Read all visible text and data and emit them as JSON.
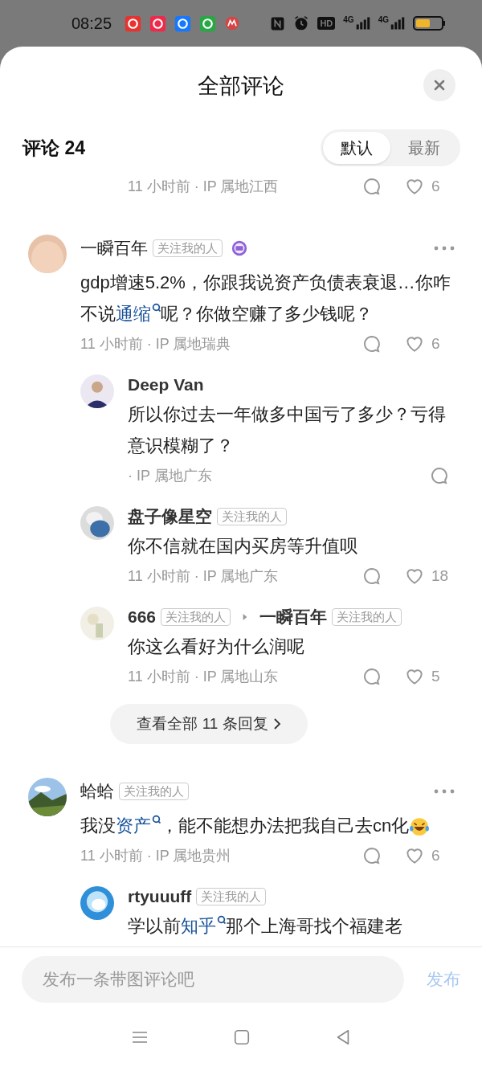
{
  "status_bar": {
    "time": "08:25",
    "hd_label": "HD",
    "networks": [
      "4G",
      "4G"
    ]
  },
  "sheet": {
    "title": "全部评论"
  },
  "comments_header": {
    "label": "评论 24",
    "sort_tabs": [
      {
        "label": "默认",
        "selected": true
      },
      {
        "label": "最新",
        "selected": false
      }
    ]
  },
  "comments": [
    {
      "meta": "11 小时前 · IP 属地江西",
      "likes": "6"
    },
    {
      "author": "一瞬百年",
      "badge": "关注我的人",
      "medal": true,
      "body": [
        {
          "kind": "text",
          "text": "gdp增速5.2%，你跟我说资产负债表衰退…你咋不说"
        },
        {
          "kind": "link",
          "text": "通缩"
        },
        {
          "kind": "text",
          "text": "呢？你做空赚了多少钱呢？"
        }
      ],
      "meta": "11 小时前 · IP 属地瑞典",
      "likes": "6",
      "replies": [
        {
          "author": "Deep Van",
          "body": [
            {
              "kind": "text",
              "text": "所以你过去一年做多中国亏了多少？亏得意识模糊了？"
            }
          ],
          "meta": "· IP 属地广东"
        },
        {
          "author": "盘子像星空",
          "badge": "关注我的人",
          "body": [
            {
              "kind": "text",
              "text": "你不信就在国内买房等升值呗"
            }
          ],
          "meta": "11 小时前 · IP 属地广东",
          "likes": "18"
        },
        {
          "author": "666",
          "badge": "关注我的人",
          "reply_to": {
            "author": "一瞬百年",
            "badge": "关注我的人"
          },
          "body": [
            {
              "kind": "text",
              "text": "你这么看好为什么润呢"
            }
          ],
          "meta": "11 小时前 · IP 属地山东",
          "likes": "5"
        }
      ],
      "more_replies": "查看全部 11 条回复"
    },
    {
      "author": "蛤蛤",
      "badge": "关注我的人",
      "medal": false,
      "body": [
        {
          "kind": "text",
          "text": "我没"
        },
        {
          "kind": "link",
          "text": "资产"
        },
        {
          "kind": "text",
          "text": "，能不能想办法把我自己去cn化"
        },
        {
          "kind": "emoji"
        }
      ],
      "meta": "11 小时前 · IP 属地贵州",
      "likes": "6",
      "replies": [
        {
          "author": "rtyuuuff",
          "badge": "关注我的人",
          "body": [
            {
              "kind": "text",
              "text": "学以前"
            },
            {
              "kind": "link",
              "text": "知乎"
            },
            {
              "kind": "text",
              "text": "那个上海哥找个福建老"
            }
          ]
        }
      ]
    }
  ],
  "composer": {
    "placeholder": "发布一条带图评论吧",
    "submit": "发布"
  }
}
